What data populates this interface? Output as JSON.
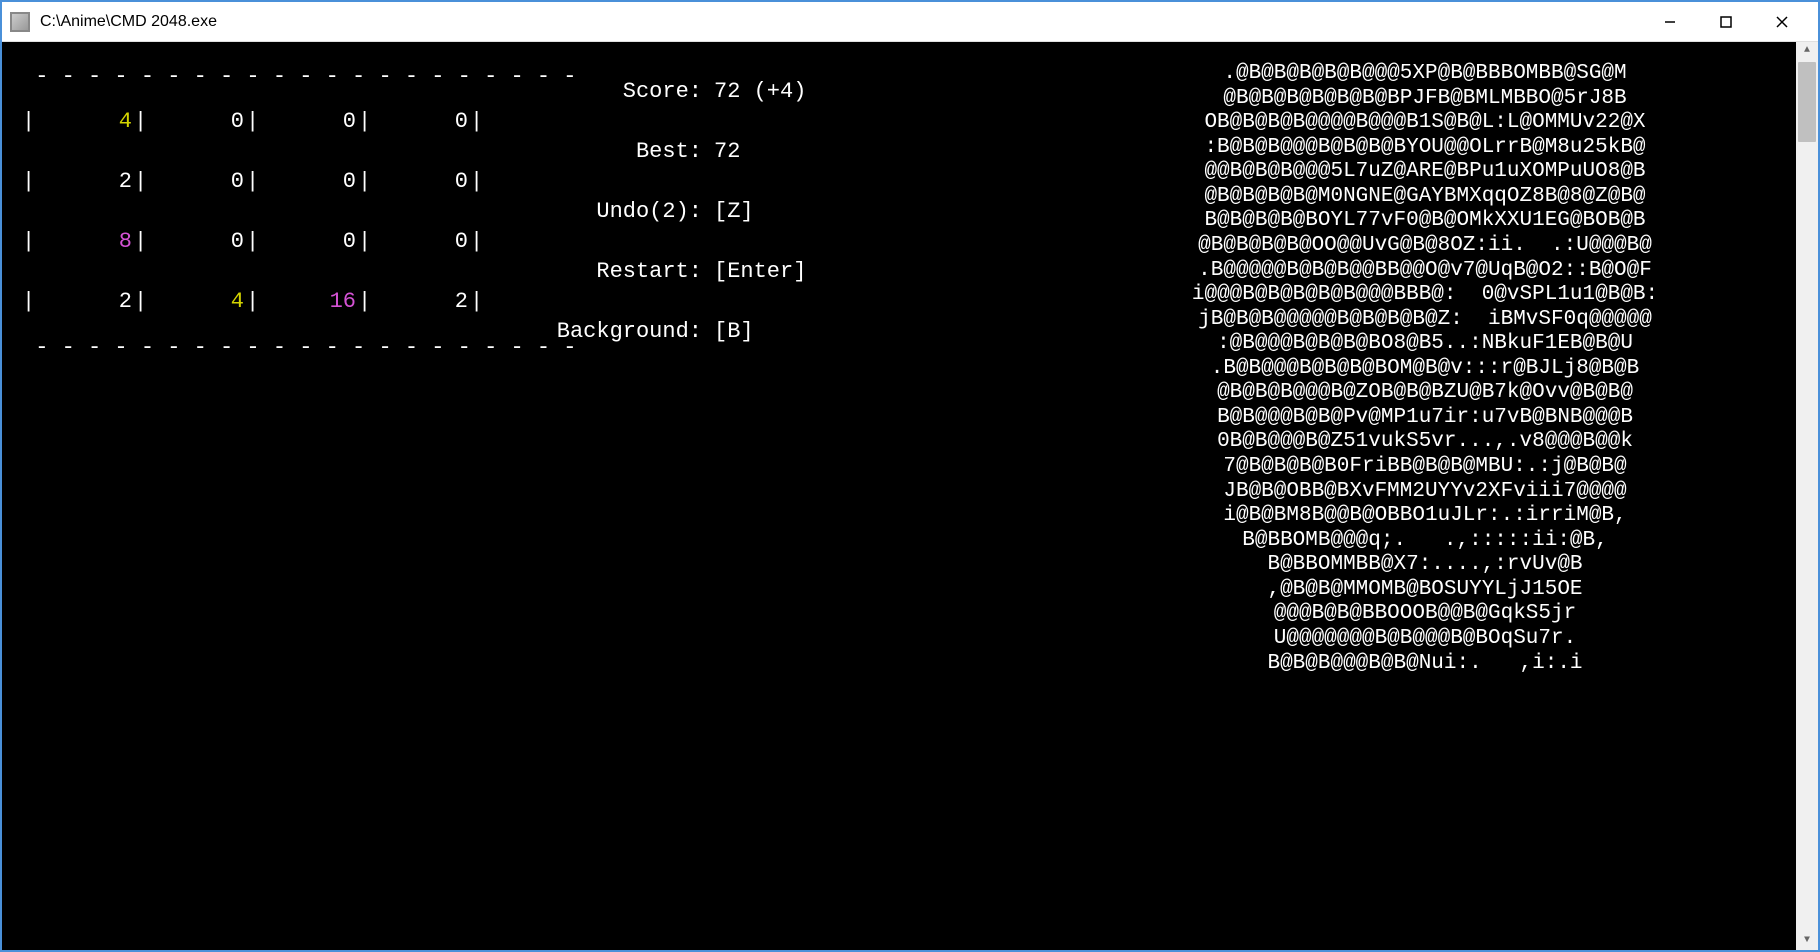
{
  "window": {
    "title": "C:\\Anime\\CMD 2048.exe"
  },
  "game": {
    "board": [
      [
        {
          "v": "4",
          "c": "yellow"
        },
        {
          "v": "0",
          "c": "white"
        },
        {
          "v": "0",
          "c": "white"
        },
        {
          "v": "0",
          "c": "white"
        }
      ],
      [
        {
          "v": "2",
          "c": "white"
        },
        {
          "v": "0",
          "c": "white"
        },
        {
          "v": "0",
          "c": "white"
        },
        {
          "v": "0",
          "c": "white"
        }
      ],
      [
        {
          "v": "8",
          "c": "pink"
        },
        {
          "v": "0",
          "c": "white"
        },
        {
          "v": "0",
          "c": "white"
        },
        {
          "v": "0",
          "c": "white"
        }
      ],
      [
        {
          "v": "2",
          "c": "white"
        },
        {
          "v": "4",
          "c": "yellow"
        },
        {
          "v": "16",
          "c": "mag"
        },
        {
          "v": "2",
          "c": "white"
        }
      ]
    ],
    "divider": " - - - - - - - - - - - - - - - - - - - - -",
    "info": {
      "score_label": "Score:",
      "score_value": "72 (+4)",
      "best_label": "Best:",
      "best_value": "72",
      "undo_label": "Undo(2):",
      "undo_value": "[Z]",
      "restart_label": "Restart:",
      "restart_value": "[Enter]",
      "bg_label": "Background:",
      "bg_value": "[B]"
    }
  },
  "ascii_art": [
    ".@B@B@B@B@B@@@5XP@B@BBBOMBB@SG@M",
    "@B@B@B@B@B@B@BPJFB@BMLMBBO@5rJ8B",
    "OB@B@B@B@@@@B@@@B1S@B@L:L@OMMUv22@X",
    ":B@B@B@@@B@B@B@BYOU@@OLrrB@M8u25kB@",
    "@@B@B@B@@@5L7uZ@ARE@BPu1uXOMPuUO8@B",
    "@B@B@B@B@M0NGNE@GAYBMXqqOZ8B@8@Z@B@",
    "B@B@B@B@BOYL77vF0@B@OMkXXU1EG@BOB@B",
    "@B@B@B@B@OO@@UvG@B@8OZ:ii.  .:U@@@B@",
    ".B@@@@@B@B@B@@BB@@O@v7@UqB@O2::B@O@F",
    "i@@@B@B@B@B@B@@@BBB@:  0@vSPL1u1@B@B:",
    "jB@B@B@@@@@B@B@B@B@Z:  iBMvSF0q@@@@@",
    ":@B@@@B@B@B@BO8@B5..:NBkuF1EB@B@U",
    ".B@B@@@B@B@B@BOM@B@v:::r@BJLj8@B@B",
    "@B@B@B@@@B@ZOB@B@BZU@B7k@Ovv@B@B@",
    "B@B@@@B@B@Pv@MP1u7ir:u7vB@BNB@@@B",
    "0B@B@@@B@Z51vukS5vr...,.v8@@@B@@k",
    "7@B@B@B@B0FriBB@B@B@MBU:.:j@B@B@",
    "JB@B@OBB@BXvFMM2UYYv2XFviii7@@@@",
    "i@B@BM8B@@B@OBBO1uJLr:.:irriM@B,",
    "B@BBOMB@@@q;.   .,:::::ii:@B,",
    "B@BBOMMBB@X7:....,:rvUv@B",
    ",@B@B@MMOMB@BOSUYYLjJ15OE",
    "@@@B@B@BBOOOB@@B@GqkS5jr",
    "U@@@@@@@B@B@@@B@BOqSu7r.",
    "B@B@B@@@B@B@Nui:.   ,i:.i"
  ]
}
